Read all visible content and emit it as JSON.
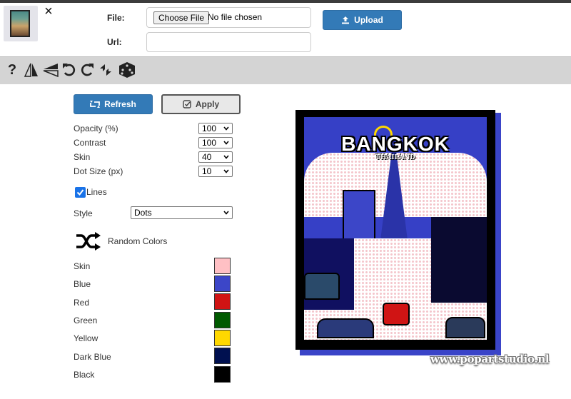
{
  "header": {
    "file_label": "File:",
    "url_label": "Url:",
    "choose_file_label": "Choose File",
    "no_file_text": "No file chosen",
    "url_value": "",
    "upload_label": "Upload"
  },
  "toolbar": {
    "icons": [
      "help-icon",
      "flip-horizontal-icon",
      "flip-vertical-icon",
      "rotate-left-icon",
      "rotate-right-icon",
      "swap-icon",
      "dice-icon"
    ],
    "help_glyph": "?"
  },
  "controls": {
    "refresh_label": "Refresh",
    "apply_label": "Apply",
    "settings": [
      {
        "label": "Opacity (%)",
        "value": "100"
      },
      {
        "label": "Contrast",
        "value": "100"
      },
      {
        "label": "Skin",
        "value": "40"
      },
      {
        "label": "Dot Size (px)",
        "value": "10"
      }
    ],
    "lines_label": "Lines",
    "lines_checked": true,
    "style_label": "Style",
    "style_value": "Dots",
    "random_colors_label": "Random Colors",
    "colors": [
      {
        "label": "Skin",
        "hex": "#ffc0c4"
      },
      {
        "label": "Blue",
        "hex": "#3c46c8"
      },
      {
        "label": "Red",
        "hex": "#d01414"
      },
      {
        "label": "Green",
        "hex": "#005a00"
      },
      {
        "label": "Yellow",
        "hex": "#ffd800"
      },
      {
        "label": "Dark Blue",
        "hex": "#001050"
      },
      {
        "label": "Black",
        "hex": "#000000"
      }
    ]
  },
  "preview": {
    "title": "BANGKOK",
    "subtitle": "THAILAND",
    "watermark": "www.popartstudio.nl"
  }
}
